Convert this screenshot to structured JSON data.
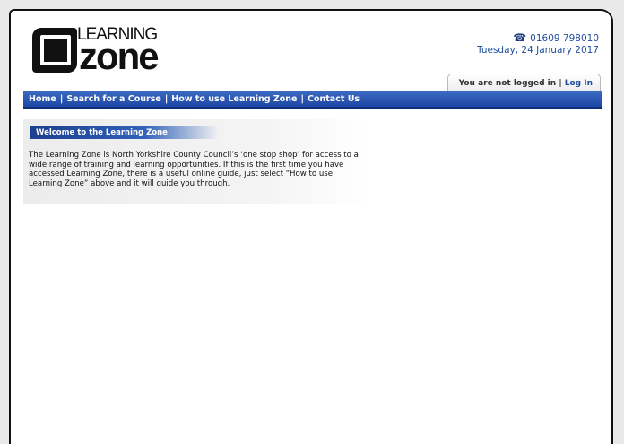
{
  "header": {
    "logo": {
      "word_top": "LEARNING",
      "word_bottom": "zone"
    },
    "phone_icon": "phone-icon",
    "phone": "01609 798010",
    "date": "Tuesday, 24 January 2017"
  },
  "login": {
    "status": "You are not logged in",
    "separator": "|",
    "link": "Log In"
  },
  "nav": {
    "items": [
      "Home",
      "Search for a Course",
      "How to use Learning Zone",
      "Contact Us"
    ],
    "separator": "|"
  },
  "welcome": {
    "title": "Welcome to the Learning Zone",
    "text": "The Learning Zone is North Yorkshire County Council’s ‘one stop shop’ for access to a wide range of training and learning opportunities. If this is the first time you have accessed Learning Zone, there is a useful online guide, just select “How to use Learning Zone” above and it will guide you through."
  },
  "colors": {
    "accent": "#1f4e9e",
    "nav_bg": "#2a56b5"
  }
}
